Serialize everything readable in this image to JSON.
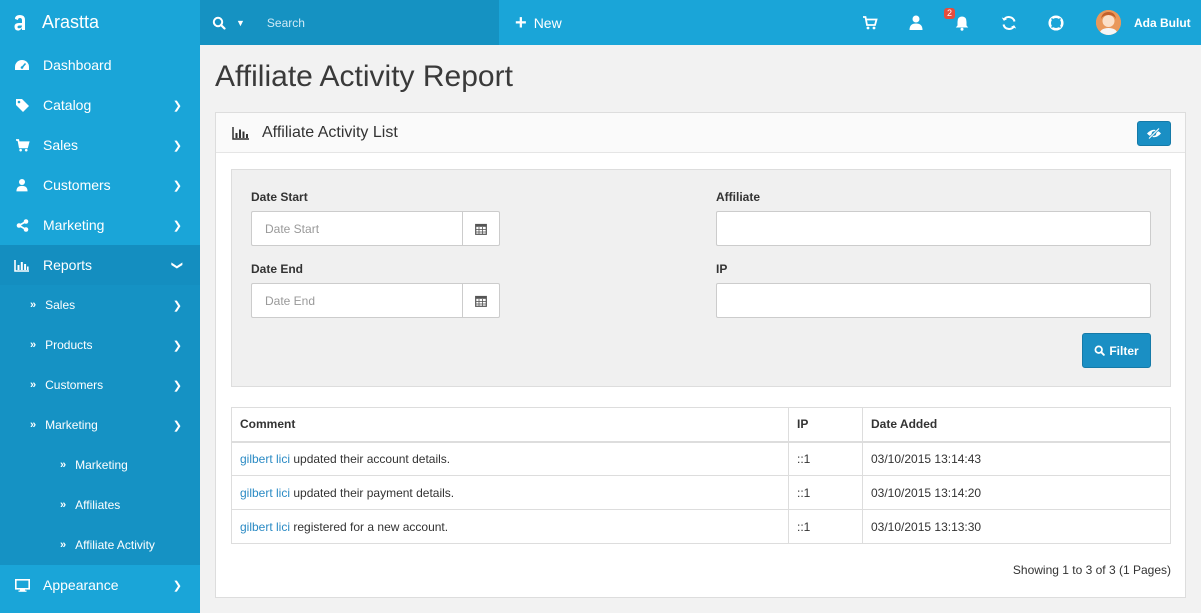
{
  "brand": {
    "name": "Arastta"
  },
  "search": {
    "placeholder": "Search"
  },
  "topbar": {
    "new_label": "New",
    "notification_count": "2",
    "user_name": "Ada Bulut"
  },
  "sidebar": {
    "items": [
      {
        "label": "Dashboard",
        "icon": "dashboard-icon"
      },
      {
        "label": "Catalog",
        "icon": "tag-icon"
      },
      {
        "label": "Sales",
        "icon": "cart-icon"
      },
      {
        "label": "Customers",
        "icon": "user-icon"
      },
      {
        "label": "Marketing",
        "icon": "share-icon"
      },
      {
        "label": "Reports",
        "icon": "bar-chart-icon"
      }
    ],
    "report_sub": [
      {
        "label": "Sales"
      },
      {
        "label": "Products"
      },
      {
        "label": "Customers"
      },
      {
        "label": "Marketing"
      }
    ],
    "marketing_sub": [
      {
        "label": "Marketing"
      },
      {
        "label": "Affiliates"
      },
      {
        "label": "Affiliate Activity"
      }
    ],
    "appearance": {
      "label": "Appearance",
      "icon": "monitor-icon"
    }
  },
  "page": {
    "title": "Affiliate Activity Report"
  },
  "panel": {
    "title": "Affiliate Activity List"
  },
  "filter": {
    "date_start_label": "Date Start",
    "date_start_placeholder": "Date Start",
    "date_end_label": "Date End",
    "date_end_placeholder": "Date End",
    "affiliate_label": "Affiliate",
    "ip_label": "IP",
    "button_label": "Filter"
  },
  "table": {
    "headers": [
      "Comment",
      "IP",
      "Date Added"
    ],
    "rows": [
      {
        "name": "gilbert lici",
        "comment": " updated their account details.",
        "ip": "::1",
        "date": "03/10/2015 13:14:43"
      },
      {
        "name": "gilbert lici",
        "comment": " updated their payment details.",
        "ip": "::1",
        "date": "03/10/2015 13:14:20"
      },
      {
        "name": "gilbert lici",
        "comment": " registered for a new account.",
        "ip": "::1",
        "date": "03/10/2015 13:13:30"
      }
    ]
  },
  "pagination": {
    "summary": "Showing 1 to 3 of 3 (1 Pages)"
  },
  "colors": {
    "accent": "#1aa5d8",
    "button": "#1a8fc4",
    "link": "#2a8ac4"
  }
}
